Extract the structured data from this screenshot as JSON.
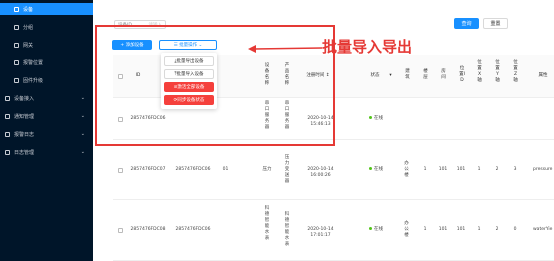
{
  "sidebar": {
    "items": [
      {
        "label": "设备",
        "active": true
      },
      {
        "label": "分组"
      },
      {
        "label": "网关"
      },
      {
        "label": "报警位置"
      },
      {
        "label": "固件升级"
      },
      {
        "label": "设备接入"
      },
      {
        "label": "通知管理"
      },
      {
        "label": "报警日志"
      },
      {
        "label": "日志管理"
      }
    ]
  },
  "toolbar": {
    "filter_label": "设备ID",
    "filter_placeholder": "请输入",
    "query_label": "查询",
    "reset_label": "重置",
    "add_label": "+ 添加设备",
    "batch_label": "☰ 批量操作 ⌄"
  },
  "dropdown": {
    "items": [
      "批量导出设备",
      "批量导入设备",
      "激活全部设备",
      "同步设备状态"
    ]
  },
  "annotation": {
    "text": "批量导入导出",
    "color": "#e53935"
  },
  "table": {
    "headers": {
      "id": "ID",
      "name": "设备名称",
      "code": "设备编码",
      "model": "产品名称",
      "product": "产品名称",
      "reg_time": "注册时间 ↕",
      "status": "状态",
      "building": "建筑",
      "floor": "楼层",
      "room": "房间",
      "pos_id": "位置ID",
      "x": "位置X轴",
      "y": "位置Y轴",
      "z": "位置Z轴",
      "attr": "属性"
    },
    "rows": [
      {
        "id": "2857476FDC06",
        "name": "",
        "code": "",
        "model": "串口服务器",
        "product": "串口服务器",
        "reg_time": "2020-10-14 15:46:13",
        "status": "在线",
        "building": "",
        "floor": "",
        "room": "",
        "pos_id": "",
        "x": "",
        "y": "",
        "z": "",
        "attr": ""
      },
      {
        "id": "2857476FDC07",
        "name": "2857476FDC06",
        "code": "01",
        "model": "压力",
        "product": "压力变送器",
        "reg_time": "2020-10-14 16:00:26",
        "status": "在线",
        "building": "办公楼",
        "floor": "1",
        "room": "101",
        "pos_id": "101",
        "x": "1",
        "y": "2",
        "z": "3",
        "attr": "pressure"
      },
      {
        "id": "2857476FDC08",
        "name": "2857476FDC06",
        "code": "",
        "model": "科德智能水表",
        "product": "科德智能水表",
        "reg_time": "2020-10-14 17:01:17",
        "status": "在线",
        "building": "办公楼",
        "floor": "1",
        "room": "101",
        "pos_id": "101",
        "x": "1",
        "y": "2",
        "z": "0",
        "attr": "waterYie"
      }
    ]
  }
}
